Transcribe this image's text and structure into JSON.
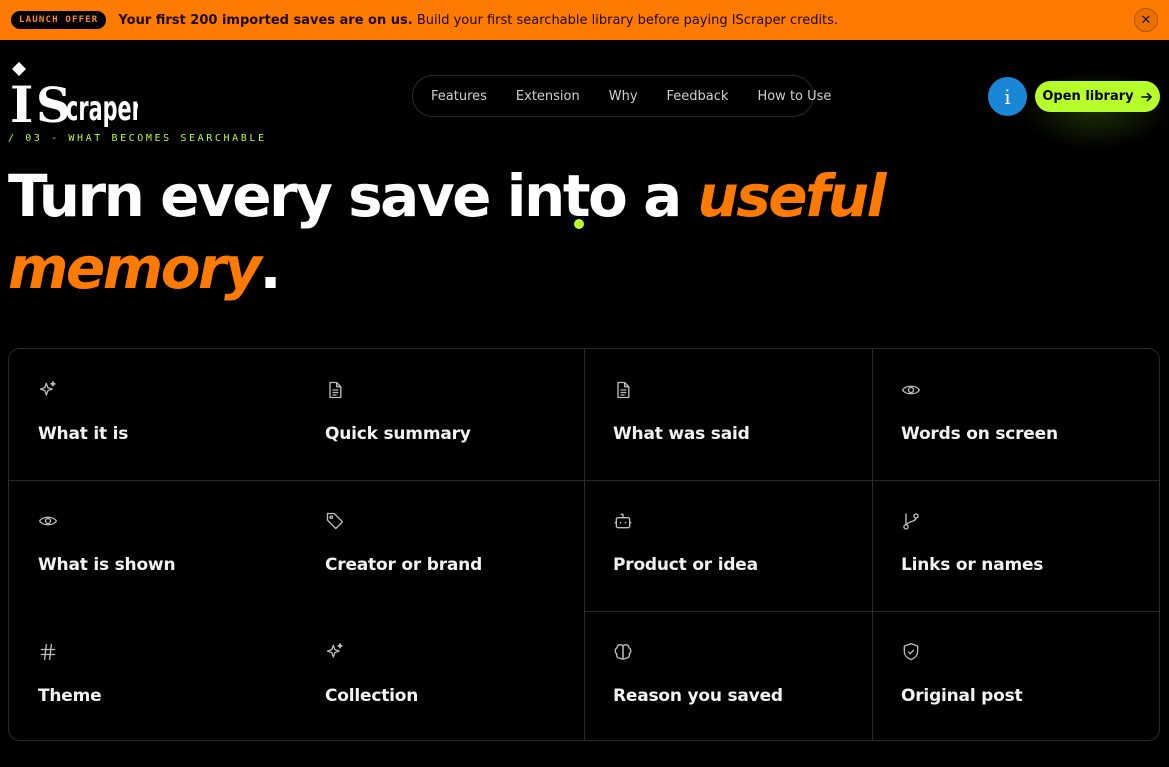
{
  "banner": {
    "badge": "LAUNCH OFFER",
    "headline": "Your first 200 imported saves are on us.",
    "text": " Build your first searchable library before paying IScraper credits.",
    "close_icon": "close-icon"
  },
  "brand": {
    "name": "IScraper",
    "section_tag": "/ 03 - WHAT BECOMES SEARCHABLE"
  },
  "nav": {
    "items": [
      "Features",
      "Extension",
      "Why",
      "Feedback",
      "How to Use"
    ]
  },
  "header": {
    "info_label": "i",
    "open_library_label": "Open library",
    "open_library_icon": "arrow-right-icon"
  },
  "hero": {
    "part1": "Turn every save into a ",
    "accent1": "useful",
    "accent2": "memory",
    "end": "."
  },
  "grid": {
    "items": [
      {
        "label": "What it is",
        "icon": "sparkles-icon"
      },
      {
        "label": "Quick summary",
        "icon": "document-icon"
      },
      {
        "label": "What was said",
        "icon": "document-icon"
      },
      {
        "label": "Words on screen",
        "icon": "eye-icon"
      },
      {
        "label": "What is shown",
        "icon": "eye-icon"
      },
      {
        "label": "Creator or brand",
        "icon": "tag-icon"
      },
      {
        "label": "Product or idea",
        "icon": "bot-icon"
      },
      {
        "label": "Links or names",
        "icon": "git-branch-icon"
      },
      {
        "label": "Theme",
        "icon": "hash-icon"
      },
      {
        "label": "Collection",
        "icon": "sparkles-icon"
      },
      {
        "label": "Reason you saved",
        "icon": "brain-icon"
      },
      {
        "label": "Original post",
        "icon": "shield-check-icon"
      }
    ]
  },
  "colors": {
    "accent_orange": "#ff7a00",
    "accent_lime": "#b6ff2a",
    "info_blue": "#1a86d6",
    "background": "#000000"
  }
}
